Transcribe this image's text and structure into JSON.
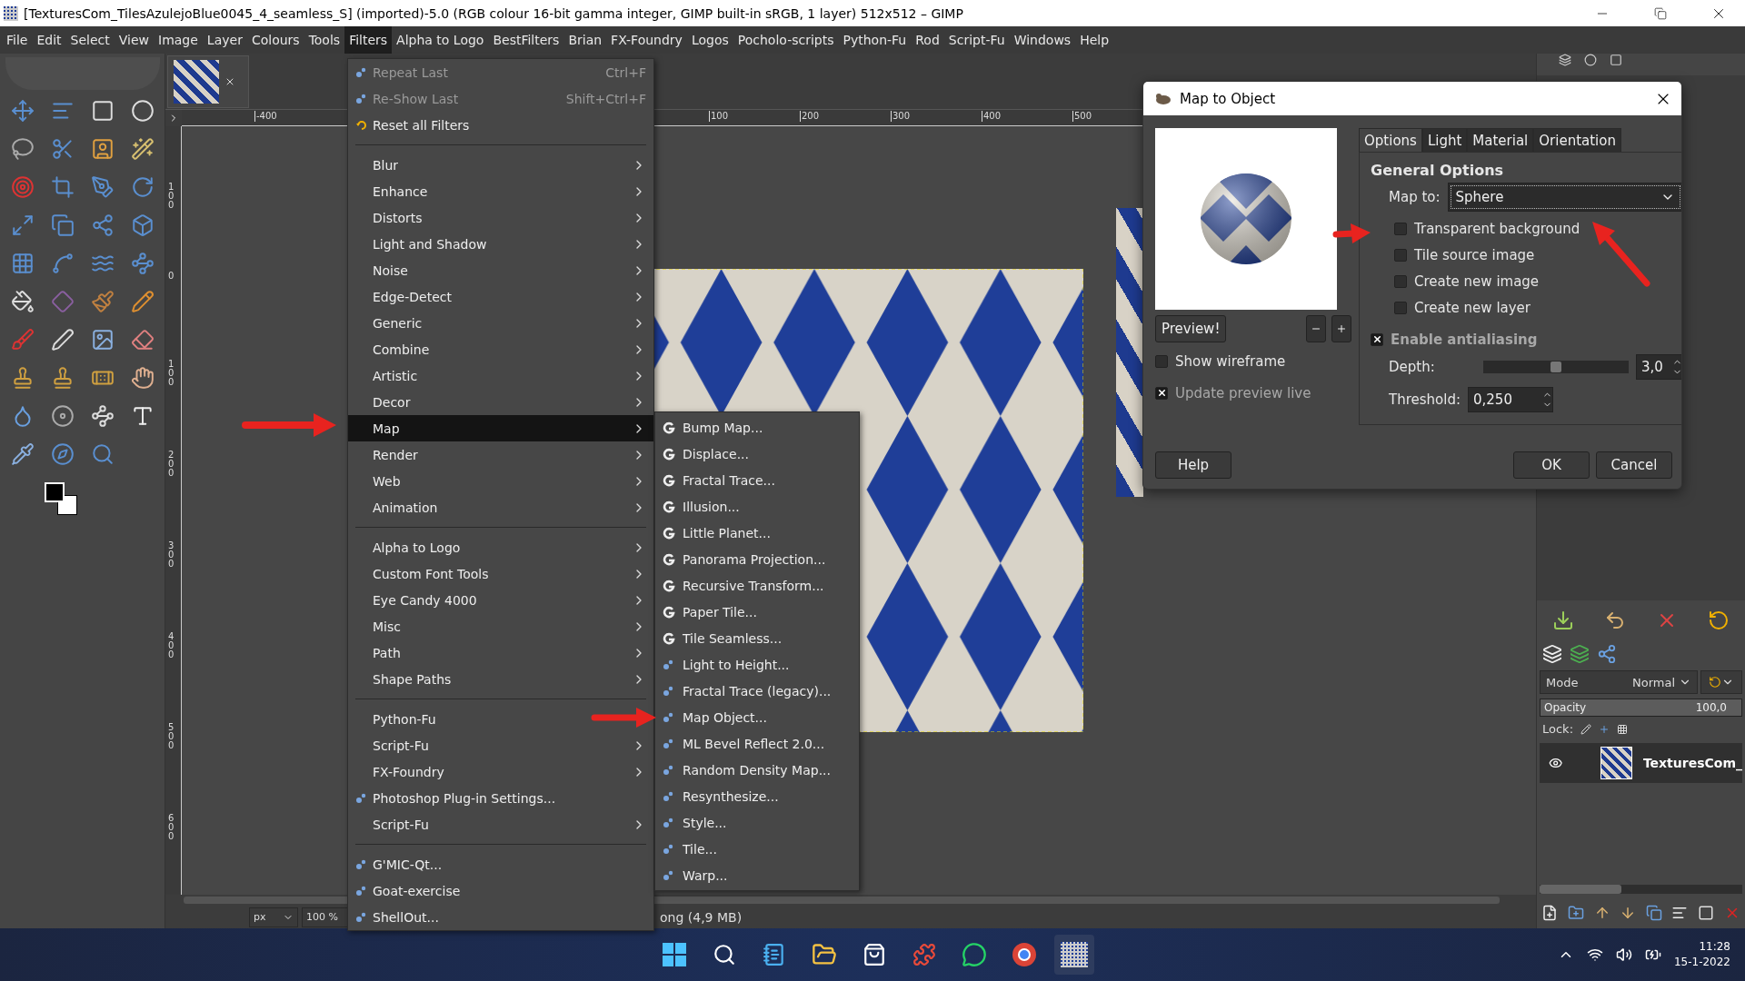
{
  "window": {
    "title": "[TexturesCom_TilesAzulejoBlue0045_4_seamless_S] (imported)-5.0 (RGB colour 16-bit gamma integer, GIMP built-in sRGB, 1 layer) 512x512 – GIMP"
  },
  "menubar": [
    {
      "label": "File",
      "selected": false
    },
    {
      "label": "Edit",
      "selected": false
    },
    {
      "label": "Select",
      "selected": false
    },
    {
      "label": "View",
      "selected": false
    },
    {
      "label": "Image",
      "selected": false
    },
    {
      "label": "Layer",
      "selected": false
    },
    {
      "label": "Colours",
      "selected": false
    },
    {
      "label": "Tools",
      "selected": false
    },
    {
      "label": "Filters",
      "selected": true
    },
    {
      "label": "Alpha to Logo",
      "selected": false
    },
    {
      "label": "BestFilters",
      "selected": false
    },
    {
      "label": "Brian",
      "selected": false
    },
    {
      "label": "FX-Foundry",
      "selected": false
    },
    {
      "label": "Logos",
      "selected": false
    },
    {
      "label": "Pocholo-scripts",
      "selected": false
    },
    {
      "label": "Python-Fu",
      "selected": false
    },
    {
      "label": "Rod",
      "selected": false
    },
    {
      "label": "Script-Fu",
      "selected": false
    },
    {
      "label": "Windows",
      "selected": false
    },
    {
      "label": "Help",
      "selected": false
    }
  ],
  "rulers": {
    "horizontal": [
      "-400",
      "100",
      "200",
      "300",
      "400",
      "500"
    ],
    "vertical": [
      "100",
      "0",
      "100",
      "200",
      "300",
      "400",
      "500",
      "600"
    ]
  },
  "filters_menu": [
    [
      {
        "label": "Repeat Last",
        "shortcut": "Ctrl+F",
        "kind": "plugin",
        "submenu": false,
        "disabled": true,
        "selected": false
      },
      {
        "label": "Re-Show Last",
        "shortcut": "Shift+Ctrl+F",
        "kind": "plugin",
        "submenu": false,
        "disabled": true,
        "selected": false
      },
      {
        "label": "Reset all Filters",
        "kind": "reset",
        "submenu": false,
        "disabled": false,
        "selected": false
      }
    ],
    [
      {
        "label": "Blur",
        "kind": "plain",
        "submenu": true,
        "disabled": false,
        "selected": false
      },
      {
        "label": "Enhance",
        "kind": "plain",
        "submenu": true,
        "disabled": false,
        "selected": false
      },
      {
        "label": "Distorts",
        "kind": "plain",
        "submenu": true,
        "disabled": false,
        "selected": false
      },
      {
        "label": "Light and Shadow",
        "kind": "plain",
        "submenu": true,
        "disabled": false,
        "selected": false
      },
      {
        "label": "Noise",
        "kind": "plain",
        "submenu": true,
        "disabled": false,
        "selected": false
      },
      {
        "label": "Edge-Detect",
        "kind": "plain",
        "submenu": true,
        "disabled": false,
        "selected": false
      },
      {
        "label": "Generic",
        "kind": "plain",
        "submenu": true,
        "disabled": false,
        "selected": false
      },
      {
        "label": "Combine",
        "kind": "plain",
        "submenu": true,
        "disabled": false,
        "selected": false
      },
      {
        "label": "Artistic",
        "kind": "plain",
        "submenu": true,
        "disabled": false,
        "selected": false
      },
      {
        "label": "Decor",
        "kind": "plain",
        "submenu": true,
        "disabled": false,
        "selected": false
      },
      {
        "label": "Map",
        "kind": "plain",
        "submenu": true,
        "disabled": false,
        "selected": true
      },
      {
        "label": "Render",
        "kind": "plain",
        "submenu": true,
        "disabled": false,
        "selected": false
      },
      {
        "label": "Web",
        "kind": "plain",
        "submenu": true,
        "disabled": false,
        "selected": false
      },
      {
        "label": "Animation",
        "kind": "plain",
        "submenu": true,
        "disabled": false,
        "selected": false
      }
    ],
    [
      {
        "label": "Alpha to Logo",
        "kind": "plain",
        "submenu": true,
        "disabled": false,
        "selected": false
      },
      {
        "label": "Custom Font Tools",
        "kind": "plain",
        "submenu": true,
        "disabled": false,
        "selected": false
      },
      {
        "label": "Eye Candy 4000",
        "kind": "plain",
        "submenu": true,
        "disabled": false,
        "selected": false
      },
      {
        "label": "Misc",
        "kind": "plain",
        "submenu": true,
        "disabled": false,
        "selected": false
      },
      {
        "label": "Path",
        "kind": "plain",
        "submenu": true,
        "disabled": false,
        "selected": false
      },
      {
        "label": "Shape Paths",
        "kind": "plain",
        "submenu": true,
        "disabled": false,
        "selected": false
      }
    ],
    [
      {
        "label": "Python-Fu",
        "kind": "plain",
        "submenu": false,
        "disabled": false,
        "selected": false
      },
      {
        "label": "Script-Fu",
        "kind": "plain",
        "submenu": true,
        "disabled": false,
        "selected": false
      },
      {
        "label": "FX-Foundry",
        "kind": "plain",
        "submenu": true,
        "disabled": false,
        "selected": false
      },
      {
        "label": "Photoshop Plug-in Settings...",
        "kind": "plugin",
        "submenu": false,
        "disabled": false,
        "selected": false
      },
      {
        "label": "Script-Fu",
        "kind": "plain",
        "submenu": true,
        "disabled": false,
        "selected": false
      }
    ],
    [
      {
        "label": "G'MIC-Qt...",
        "kind": "plugin",
        "submenu": false,
        "disabled": false,
        "selected": false
      },
      {
        "label": "Goat-exercise",
        "kind": "plugin",
        "submenu": false,
        "disabled": false,
        "selected": false
      },
      {
        "label": "ShellOut...",
        "kind": "plugin",
        "submenu": false,
        "disabled": false,
        "selected": false
      }
    ]
  ],
  "map_submenu": [
    {
      "label": "Bump Map...",
      "kind": "gegl"
    },
    {
      "label": "Displace...",
      "kind": "gegl"
    },
    {
      "label": "Fractal Trace...",
      "kind": "gegl"
    },
    {
      "label": "Illusion...",
      "kind": "gegl"
    },
    {
      "label": "Little Planet...",
      "kind": "gegl"
    },
    {
      "label": "Panorama Projection...",
      "kind": "gegl"
    },
    {
      "label": "Recursive Transform...",
      "kind": "gegl"
    },
    {
      "label": "Paper Tile...",
      "kind": "gegl"
    },
    {
      "label": "Tile Seamless...",
      "kind": "gegl"
    },
    {
      "label": "Light to Height...",
      "kind": "plugin"
    },
    {
      "label": "Fractal Trace (legacy)...",
      "kind": "plugin"
    },
    {
      "label": "Map Object...",
      "kind": "plugin"
    },
    {
      "label": "ML Bevel Reflect 2.0...",
      "kind": "plugin"
    },
    {
      "label": "Random Density Map...",
      "kind": "plugin"
    },
    {
      "label": "Resynthesize...",
      "kind": "plugin"
    },
    {
      "label": "Style...",
      "kind": "plugin"
    },
    {
      "label": "Tile...",
      "kind": "plugin"
    },
    {
      "label": "Warp...",
      "kind": "plugin"
    }
  ],
  "dialog": {
    "title": "Map to Object",
    "preview_button": "Preview!",
    "preview_options": [
      {
        "label": "Show wireframe",
        "checked": false,
        "disabled": false
      },
      {
        "label": "Update preview live",
        "checked": true,
        "disabled": true
      }
    ],
    "tabs": [
      {
        "label": "Options",
        "selected": true
      },
      {
        "label": "Light",
        "selected": false
      },
      {
        "label": "Material",
        "selected": false
      },
      {
        "label": "Orientation",
        "selected": false
      }
    ],
    "heading": "General Options",
    "map_to": {
      "label": "Map to:",
      "value": "Sphere"
    },
    "options": [
      {
        "label": "Transparent background",
        "checked": false
      },
      {
        "label": "Tile source image",
        "checked": false
      },
      {
        "label": "Create new image",
        "checked": false
      },
      {
        "label": "Create new layer",
        "checked": false
      }
    ],
    "antialiasing": {
      "label": "Enable antialiasing",
      "checked": true
    },
    "depth": {
      "label": "Depth:",
      "value": "3,0",
      "level": 0.5
    },
    "threshold": {
      "label": "Threshold:",
      "value": "0,250"
    },
    "buttons": [
      "Help",
      "OK",
      "Cancel"
    ]
  },
  "layers_panel": {
    "mode_label": "Mode",
    "mode_value": "Normal",
    "opacity_label": "Opacity",
    "opacity_value": "100,0",
    "level": 1,
    "lock_label": "Lock:",
    "layers": [
      {
        "name": "TexturesCom_",
        "visible": true
      }
    ]
  },
  "status_bar": {
    "unit": "px",
    "zoom": "100 %",
    "text": "ong (4,9 MB)"
  },
  "taskbar": {
    "time": "11:28",
    "date": "15-1-2022"
  }
}
